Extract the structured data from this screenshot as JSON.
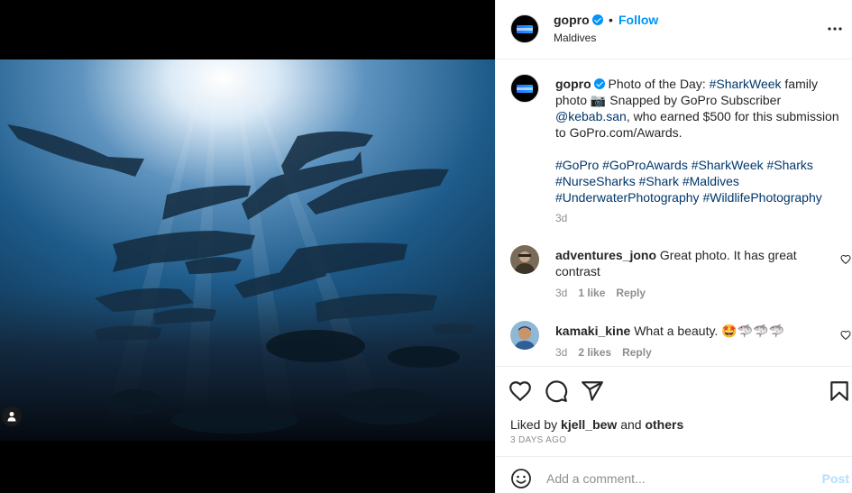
{
  "post": {
    "username": "gopro",
    "follow_label": "Follow",
    "separator": "•",
    "location": "Maldives",
    "caption": {
      "username": "gopro",
      "text_1": "Photo of the Day: ",
      "hashtag_sharkweek": "#SharkWeek",
      "text_2": " family photo 📷 Snapped by GoPro Subscriber ",
      "mention": "@kebab.san",
      "text_3": ", who earned $500 for this submission to GoPro.com/Awards.",
      "hashtags": [
        "#GoPro",
        "#GoProAwards",
        "#SharkWeek",
        "#Sharks",
        "#NurseSharks",
        "#Shark",
        "#Maldives",
        "#UnderwaterPhotography",
        "#WildlifePhotography"
      ],
      "time": "3d"
    },
    "comments": [
      {
        "username": "adventures_jono",
        "text": "Great photo. It has great contrast",
        "time": "3d",
        "likes": "1 like",
        "reply": "Reply"
      },
      {
        "username": "kamaki_kine",
        "text": "What a beauty. 🤩🦈🦈🦈",
        "time": "3d",
        "likes": "2 likes",
        "reply": "Reply"
      }
    ],
    "liked_by_prefix": "Liked by ",
    "liked_by_user": "kjell_bew",
    "liked_by_and": " and ",
    "liked_by_others": "others",
    "date": "3 DAYS AGO",
    "comment_placeholder": "Add a comment...",
    "post_label": "Post"
  },
  "icons": {
    "verified": "verified-badge-icon",
    "more": "more-options-icon",
    "like": "heart-icon",
    "comment": "comment-icon",
    "share": "share-icon",
    "save": "bookmark-icon",
    "emoji": "emoji-icon",
    "tagged": "user-tag-icon"
  },
  "colors": {
    "link_blue": "#0095f6",
    "hashtag": "#00376b",
    "muted": "#8e8e8e",
    "post_disabled": "#b2dffc"
  }
}
